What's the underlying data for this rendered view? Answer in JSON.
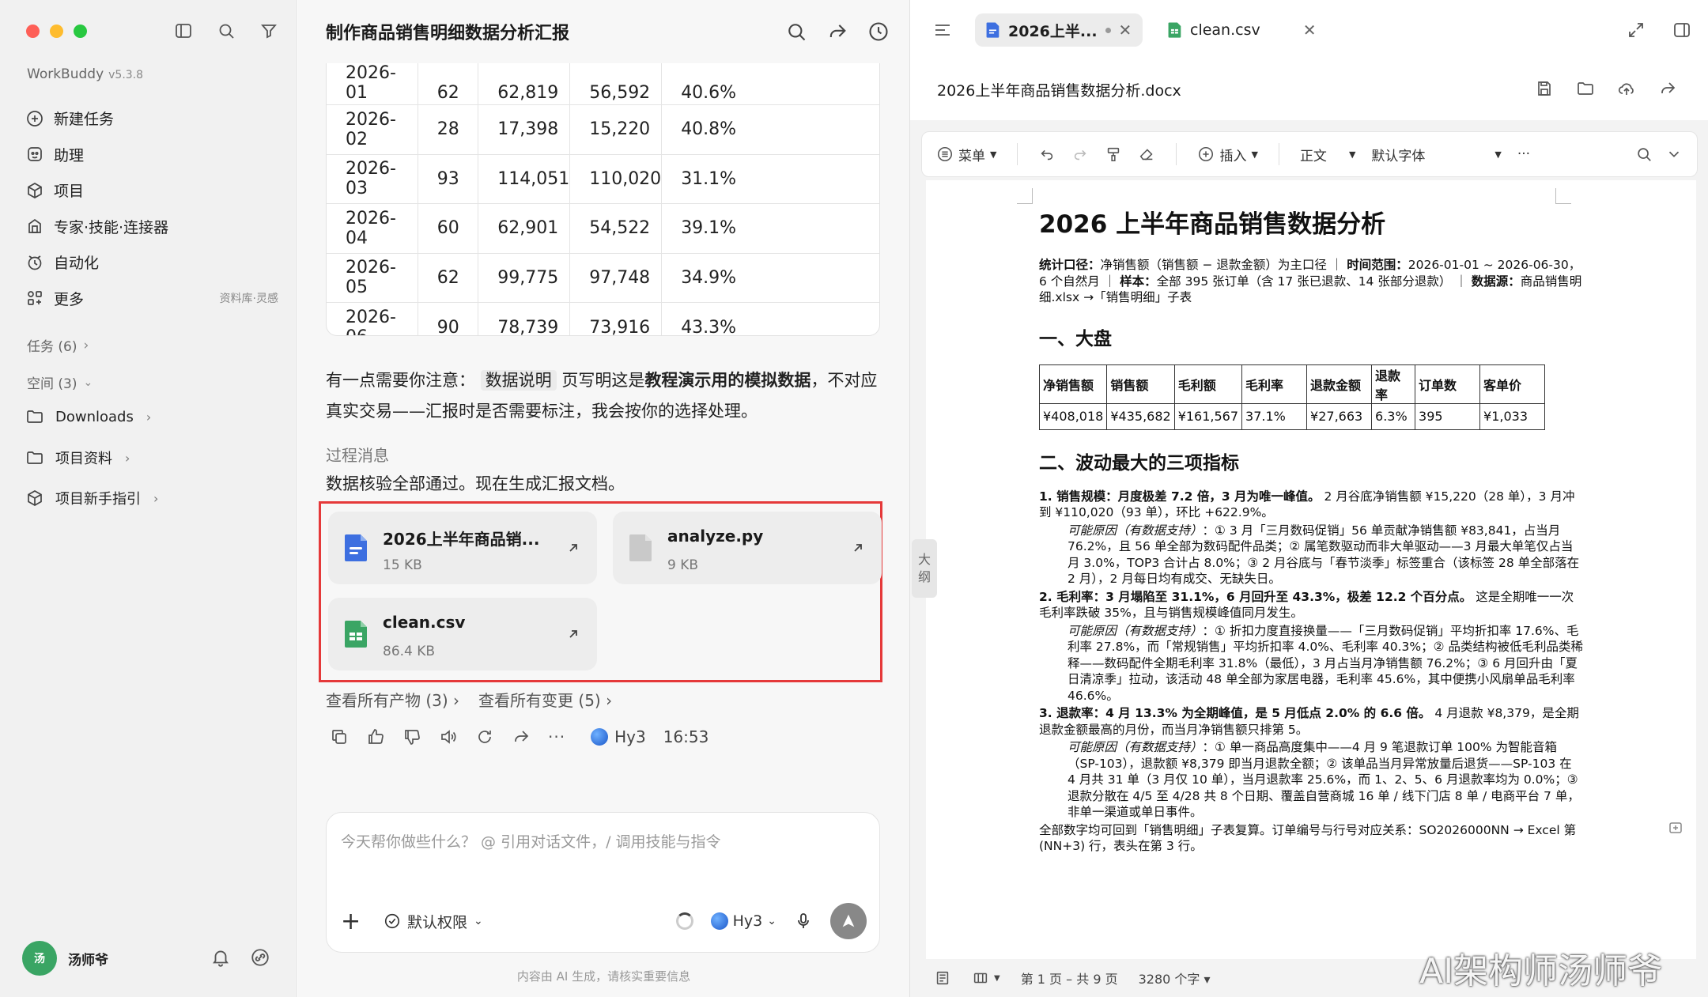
{
  "sidebar": {
    "app_name": "WorkBuddy",
    "version": "v5.3.8",
    "nav": [
      {
        "label": "新建任务",
        "icon": "plus-circle-icon"
      },
      {
        "label": "助理",
        "icon": "assistant-icon"
      },
      {
        "label": "项目",
        "icon": "project-icon"
      },
      {
        "label": "专家·技能·连接器",
        "icon": "expert-icon"
      },
      {
        "label": "自动化",
        "icon": "automation-icon"
      },
      {
        "label": "更多",
        "icon": "more-grid-icon",
        "extra": "资料库·灵感"
      }
    ],
    "tasks_label": "任务 (6)",
    "spaces_label": "空间 (3)",
    "folders": [
      "Downloads",
      "项目资料",
      "项目新手指引"
    ],
    "user_name": "汤师爷",
    "avatar_text": "汤"
  },
  "chat": {
    "title": "制作商品销售明细数据分析汇报",
    "table": {
      "rows": [
        [
          "2026-01",
          "62",
          "62,819",
          "56,592",
          "40.6%"
        ],
        [
          "2026-02",
          "28",
          "17,398",
          "15,220",
          "40.8%"
        ],
        [
          "2026-03",
          "93",
          "114,051",
          "110,020",
          "31.1%"
        ],
        [
          "2026-04",
          "60",
          "62,901",
          "54,522",
          "39.1%"
        ],
        [
          "2026-05",
          "62",
          "99,775",
          "97,748",
          "34.9%"
        ],
        [
          "2026-06",
          "90",
          "78,739",
          "73,916",
          "43.3%"
        ]
      ]
    },
    "note_prefix": "有一点需要你注意：",
    "note_chip": "数据说明",
    "note_mid": "页写明这是",
    "note_bold": "教程演示用的模拟数据",
    "note_suffix": "，不对应真实交易——汇报时是否需要标注，我会按你的选择处理。",
    "process_label": "过程消息",
    "process_text": "数据核验全部通过。现在生成汇报文档。",
    "files": [
      {
        "name": "2026上半年商品销...",
        "size": "15 KB",
        "icon": "word-doc-icon"
      },
      {
        "name": "analyze.py",
        "size": "9 KB",
        "icon": "file-icon"
      },
      {
        "name": "clean.csv",
        "size": "86.4 KB",
        "icon": "spreadsheet-icon"
      }
    ],
    "view_outputs": "查看所有产物 (3)",
    "view_changes": "查看所有变更 (5)",
    "model_name": "Hy3",
    "time": "16:53",
    "composer_placeholder": "今天帮你做些什么？ @ 引用对话文件，/ 调用技能与指令",
    "permission_label": "默认权限",
    "model_select": "Hy3",
    "footnote": "内容由 AI 生成，请核实重要信息"
  },
  "doc_panel": {
    "tabs": [
      {
        "label": "2026上半...",
        "active": true
      },
      {
        "label": "clean.csv",
        "active": false
      }
    ],
    "doc_filename": "2026上半年商品销售数据分析.docx",
    "toolbar": {
      "menu": "菜单",
      "insert": "插入",
      "style": "正文",
      "font": "默认字体",
      "more": "···"
    },
    "outline_label_1": "大",
    "outline_label_2": "纲",
    "doc": {
      "title": "2026 上半年商品销售数据分析",
      "meta_1": "统计口径：",
      "meta_2": "净销售额（销售额 − 退款金额）为主口径 ｜ ",
      "meta_3": "时间范围：",
      "meta_4": "2026-01-01 ~ 2026-06-30，6 个自然月 ｜ ",
      "meta_5": "样本：",
      "meta_6": "全部 395 张订单（含 17 张已退款、14 张部分退款） ｜ ",
      "meta_7": "数据源：",
      "meta_8": "商品销售明细.xlsx →「销售明细」子表",
      "h_overview": "一、大盘",
      "kpi_headers": [
        "净销售额",
        "销售额",
        "毛利额",
        "毛利率",
        "退款金额",
        "退款率",
        "订单数",
        "客单价"
      ],
      "kpi_values": [
        "¥408,018",
        "¥435,682",
        "¥161,567",
        "37.1%",
        "¥27,663",
        "6.3%",
        "395",
        "¥1,033"
      ],
      "h_top3": "二、波动最大的三项指标",
      "item1_bold": "1. 销售规模：月度极差 7.2 倍，3 月为唯一峰值。",
      "item1_text": " 2 月谷底净销售额 ¥15,220（28 单），3 月冲到 ¥110,020（93 单），环比 +622.9%。",
      "cause1_label": "可能原因（有数据支持）",
      "cause1_text": "：① 3 月「三月数码促销」56 单贡献净销售额 ¥83,841，占当月 76.2%，且 56 单全部为数码配件品类；② 属笔数驱动而非大单驱动——3 月最大单笔仅占当月 3.0%，TOP3 合计占 8.0%；③ 2 月谷底与「春节淡季」标签重合（该标签 28 单全部落在 2 月），2 月每日均有成交、无缺失日。",
      "item2_bold": "2. 毛利率：3 月塌陷至 31.1%，6 月回升至 43.3%，极差 12.2 个百分点。",
      "item2_text": " 这是全期唯一一次毛利率跌破 35%，且与销售规模峰值同月发生。",
      "cause2_label": "可能原因（有数据支持）",
      "cause2_text": "：① 折扣力度直接换量——「三月数码促销」平均折扣率 17.6%、毛利率 27.8%，而「常规销售」平均折扣率 4.0%、毛利率 40.3%；② 品类结构被低毛利品类稀释——数码配件全期毛利率 31.8%（最低），3 月占当月净销售额 76.2%；③ 6 月回升由「夏日清凉季」拉动，该活动 48 单全部为家居电器，毛利率 45.6%，其中便携小风扇单品毛利率 46.6%。",
      "item3_bold": "3. 退款率：4 月 13.3% 为全期峰值，是 5 月低点 2.0% 的 6.6 倍。",
      "item3_text": " 4 月退款 ¥8,379，是全期退款金额最高的月份，而当月净销售额只排第 5。",
      "cause3_label": "可能原因（有数据支持）",
      "cause3_text": "：① 单一商品高度集中——4 月 9 笔退款订单 100% 为智能音箱（SP-103），退款额 ¥8,379 即当月退款全额；② 该单品当月异常放量后退货——SP-103 在 4 月共 31 单（3 月仅 10 单），当月退款率 25.6%，而 1、2、5、6 月退款率均为 0.0%；③ 退款分散在 4/5 至 4/28 共 8 个日期、覆盖自营商城 16 单 / 线下门店 8 单 / 电商平台 7 单，非单一渠道或单日事件。",
      "tail": "全部数字均可回到「销售明细」子表复算。订单编号与行号对应关系：SO2026000NN → Excel 第 (NN+3) 行，表头在第 3 行。"
    },
    "status": {
      "page": "第 1 页 – 共 9 页",
      "words": "3280 个字"
    }
  },
  "watermark": "AI架构师汤师爷",
  "colors": {
    "highlight_border": "#e5393a",
    "word_blue": "#3d6fe0",
    "sheet_green": "#3aa564",
    "traffic_red": "#fe5f57",
    "traffic_yellow": "#febc2e",
    "traffic_green": "#28c840"
  }
}
